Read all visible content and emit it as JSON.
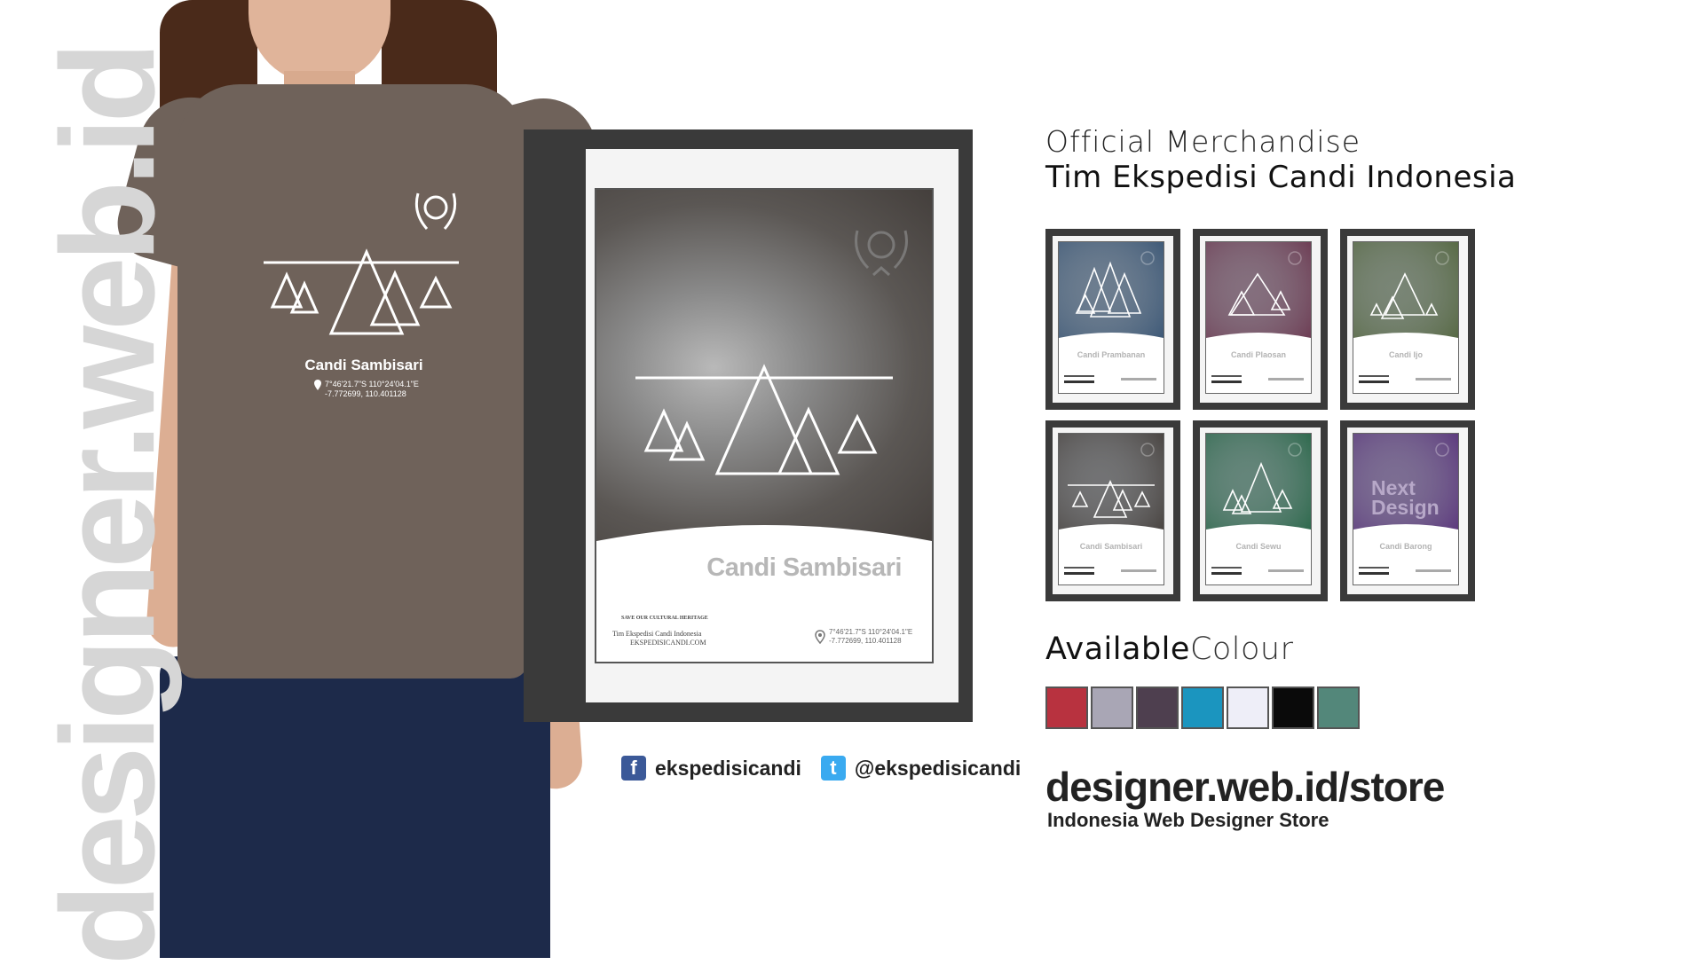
{
  "watermark": "designer.web.id",
  "header": {
    "line1": "Official Merchandise",
    "line2": "Tim Ekspedisi Candi Indonesia"
  },
  "shirt": {
    "title": "Candi Sambisari",
    "coords_dms": "7°46'21.7\"S 110°24'04.1\"E",
    "coords_dec": "-7.772699, 110.401128",
    "color": "#6f625a"
  },
  "poster": {
    "title": "Candi Sambisari",
    "tagline": "SAVE OUR CULTURAL HERITAGE",
    "org": "Tim Ekspedisi Candi Indonesia",
    "site": "EKSPEDISICANDI.COM",
    "coords_dms": "7°46'21.7\"S 110°24'04.1\"E",
    "coords_dec": "-7.772699, 110.401128"
  },
  "designs": [
    {
      "label": "Candi Prambanan",
      "color": "#3f5a78"
    },
    {
      "label": "Candi Plaosan",
      "color": "#6e3e55"
    },
    {
      "label": "Candi Ijo",
      "color": "#586a45"
    },
    {
      "label": "Candi Sambisari",
      "color": "#4a4542"
    },
    {
      "label": "Candi Sewu",
      "color": "#2f6a4e"
    },
    {
      "label": "Candi Barong",
      "color": "#5d3a7e",
      "next_line1": "Next",
      "next_line2": "Design"
    }
  ],
  "available": {
    "bold": "Available",
    "light": "Colour",
    "swatches": [
      "#b8323f",
      "#a9a6b5",
      "#4e3f4f",
      "#1b95bf",
      "#eeeef8",
      "#0a0a0a",
      "#53877a"
    ]
  },
  "social": {
    "facebook_icon": "facebook-icon",
    "facebook": "ekspedisicandi",
    "twitter_icon": "twitter-icon",
    "twitter": "@ekspedisicandi"
  },
  "store": {
    "url": "designer.web.id/store",
    "subtitle": "Indonesia Web Designer Store"
  }
}
